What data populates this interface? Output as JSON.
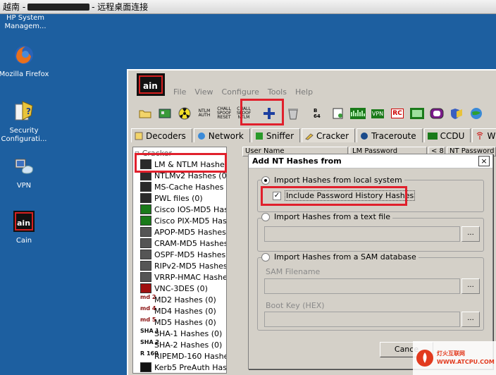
{
  "window_title_prefix": "越南 -",
  "window_title_suffix": "- 远程桌面连接",
  "desktop_icons": [
    {
      "label": "HP System Managem...",
      "icon": "hp-icon"
    },
    {
      "label": "Mozilla Firefox",
      "icon": "firefox-icon"
    },
    {
      "label": "Security Configurati...",
      "icon": "security-config-icon"
    },
    {
      "label": "VPN",
      "icon": "vpn-icon"
    },
    {
      "label": "Cain",
      "icon": "cain-icon"
    }
  ],
  "cain": {
    "menu": [
      "File",
      "View",
      "Configure",
      "Tools",
      "Help"
    ],
    "toolbar_icons": [
      "open-folder-icon",
      "network-card-icon",
      "radiation-icon",
      "ntlm-auth-icon",
      "chall-spoof-reset-icon",
      "chall-spoof-ntlm-icon",
      "add-plus-icon",
      "delete-bin-icon",
      "base64-icon",
      "certificate-icon",
      "grid-green-icon",
      "vpn-green-icon",
      "rc-icon",
      "calculator-icon",
      "ring-icon",
      "shield-question-icon",
      "globe-help-icon"
    ],
    "toolbar_labels": {
      "ntlm_auth": "NTLM AUTH",
      "chall_spoof_reset": "CHALL SPOOF RESET",
      "chall_spoof_ntlm": "CHALL SPOOF NTLM",
      "b64": "B 64",
      "vpn": "VPN",
      "rc": "RC"
    },
    "tabs": [
      "Decoders",
      "Network",
      "Sniffer",
      "Cracker",
      "Traceroute",
      "CCDU",
      "W"
    ],
    "tree_root": "Cracker",
    "tree_items": [
      {
        "label": "LM & NTLM Hashes (",
        "icon": "lm-ntlm-icon"
      },
      {
        "label": "NTLMv2 Hashes (0)",
        "icon": "ntlmv2-icon"
      },
      {
        "label": "MS-Cache Hashes (",
        "icon": "ms-cache-icon"
      },
      {
        "label": "PWL files (0)",
        "icon": "pwl-icon"
      },
      {
        "label": "Cisco IOS-MD5 Hash",
        "icon": "cisco-ios-icon"
      },
      {
        "label": "Cisco PIX-MD5 Hash",
        "icon": "cisco-pix-icon"
      },
      {
        "label": "APOP-MD5 Hashes (",
        "icon": "apop-icon"
      },
      {
        "label": "CRAM-MD5 Hashes",
        "icon": "cram-icon"
      },
      {
        "label": "OSPF-MD5 Hashes (",
        "icon": "ospf-icon"
      },
      {
        "label": "RIPv2-MD5 Hashes",
        "icon": "ripv2-icon"
      },
      {
        "label": "VRRP-HMAC Hashes",
        "icon": "vrrp-icon"
      },
      {
        "label": "VNC-3DES (0)",
        "icon": "vnc-icon"
      },
      {
        "label": "MD2 Hashes (0)",
        "icon": "md2-icon",
        "tag": "md 2"
      },
      {
        "label": "MD4 Hashes (0)",
        "icon": "md4-icon",
        "tag": "md 4"
      },
      {
        "label": "MD5 Hashes (0)",
        "icon": "md5-icon",
        "tag": "md 5"
      },
      {
        "label": "SHA-1 Hashes (0)",
        "icon": "sha1-icon",
        "tag": "SHA 1"
      },
      {
        "label": "SHA-2 Hashes (0)",
        "icon": "sha2-icon",
        "tag": "SHA 2"
      },
      {
        "label": "RIPEMD-160 Hashes",
        "icon": "ripemd-icon",
        "tag": "R 160"
      },
      {
        "label": "Kerb5 PreAuth Hash",
        "icon": "kerb5-icon"
      }
    ],
    "list_headers": [
      "User Name",
      "LM Password",
      "< 8",
      "NT Password"
    ]
  },
  "dialog": {
    "title": "Add NT Hashes from",
    "close": "×",
    "opt_local": "Import Hashes from local system",
    "chk_history": "Include Password History Hashes",
    "opt_text": "Import Hashes from a text file",
    "opt_sam": "Import Hashes from a SAM database",
    "sam_label": "SAM Filename",
    "bootkey_label": "Boot Key (HEX)",
    "browse": "...",
    "cancel": "Cance"
  },
  "colors": {
    "highlight_red": "#e0202c",
    "desktop_blue": "#1d5fa0"
  }
}
